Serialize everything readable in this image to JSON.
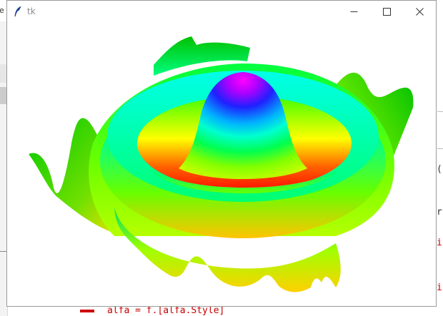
{
  "window": {
    "title": "tk",
    "app_icon": "tk-feather-icon",
    "controls": [
      "minimize-icon",
      "maximize-icon",
      "close-icon"
    ]
  },
  "background_app": {
    "left_letter": "e",
    "right_code": [
      "(",
      "r",
      "i",
      "i"
    ],
    "right_colors": [
      "#333333",
      "#333333",
      "#c80000",
      "#c80000"
    ],
    "bottom_code": "alfa = f.[alfa.Style]"
  },
  "surface_plot": {
    "description_icon": "3d-sinc-surface",
    "colors": [
      "#ff0000",
      "#ffff00",
      "#00ff00",
      "#00ffff",
      "#0000ff",
      "#ff00ff"
    ]
  }
}
